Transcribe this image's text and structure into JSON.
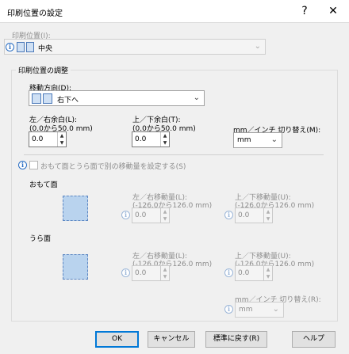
{
  "window": {
    "title": "印刷位置の設定",
    "help_glyph": "?",
    "close_glyph": "✕"
  },
  "print_position": {
    "label": "印刷位置(I):",
    "value": "中央"
  },
  "adjust": {
    "group_title": "印刷位置の調整",
    "direction_label": "移動方向(D):",
    "direction_value": "右下へ",
    "lr_margin_label1": "左／右余白(L):",
    "lr_margin_label2": "(0.0から50.0 mm)",
    "lr_margin_value": "0.0",
    "tb_margin_label1": "上／下余白(T):",
    "tb_margin_label2": "(0.0から50.0 mm)",
    "tb_margin_value": "0.0",
    "unit_label": "mm／インチ 切り替え(M):",
    "unit_value": "mm"
  },
  "separate": {
    "checkbox_label": "おもて面とうら面で別の移動量を設定する(S)",
    "checked": false
  },
  "front": {
    "heading": "おもて面",
    "lr_label1": "左／右移動量(L):",
    "lr_label2": "(-126.0から126.0 mm)",
    "lr_value": "0.0",
    "tb_label1": "上／下移動量(U):",
    "tb_label2": "(-126.0から126.0 mm)",
    "tb_value": "0.0"
  },
  "back": {
    "heading": "うら面",
    "lr_label1": "左／右移動量(L):",
    "lr_label2": "(-126.0から126.0 mm)",
    "lr_value": "0.0",
    "tb_label1": "上／下移動量(U):",
    "tb_label2": "(-126.0から126.0 mm)",
    "tb_value": "0.0",
    "unit_label": "mm／インチ 切り替え(R):",
    "unit_value": "mm"
  },
  "buttons": {
    "ok": "OK",
    "cancel": "キャンセル",
    "defaults": "標準に戻す(R)",
    "help": "ヘルプ"
  },
  "icons": {
    "info": "i",
    "spin_up": "▲",
    "spin_down": "▼",
    "chevron": "⌄"
  }
}
